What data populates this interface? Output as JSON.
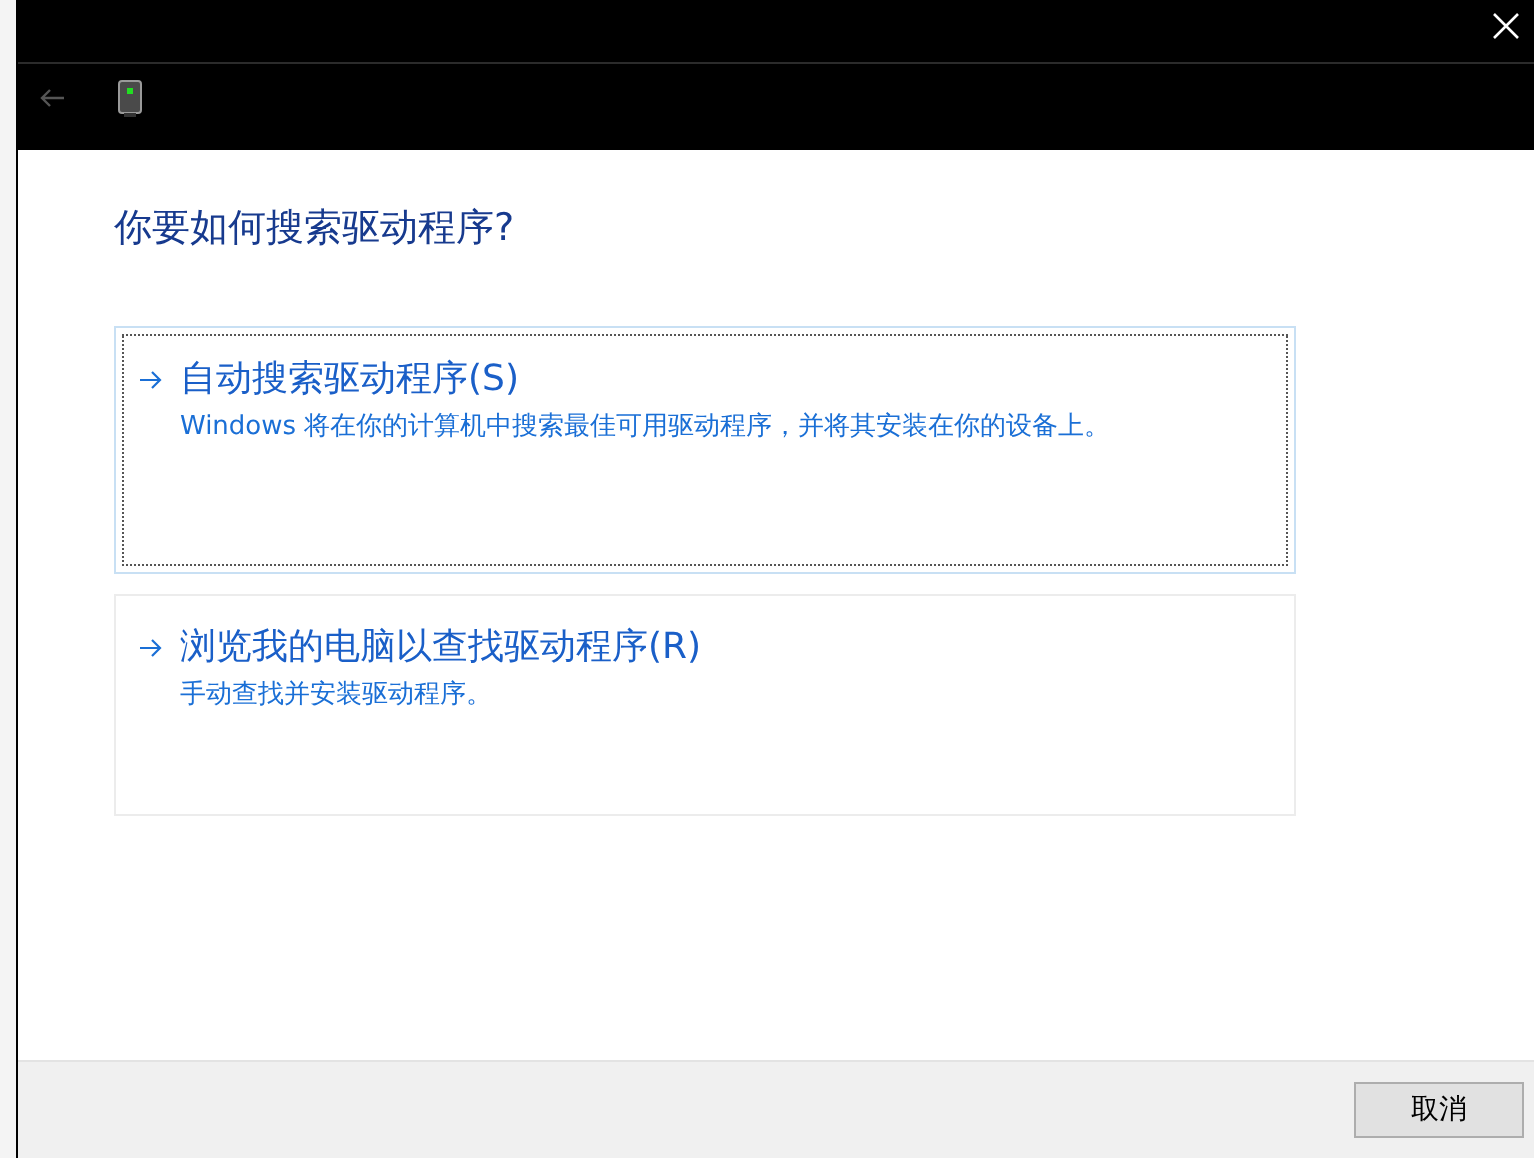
{
  "heading": "你要如何搜索驱动程序?",
  "options": [
    {
      "title": "自动搜索驱动程序(S)",
      "description": "Windows 将在你的计算机中搜索最佳可用驱动程序，并将其安装在你的设备上。",
      "focused": true
    },
    {
      "title": "浏览我的电脑以查找驱动程序(R)",
      "description": "手动查找并安装驱动程序。",
      "focused": false
    }
  ],
  "buttons": [
    "取消"
  ]
}
